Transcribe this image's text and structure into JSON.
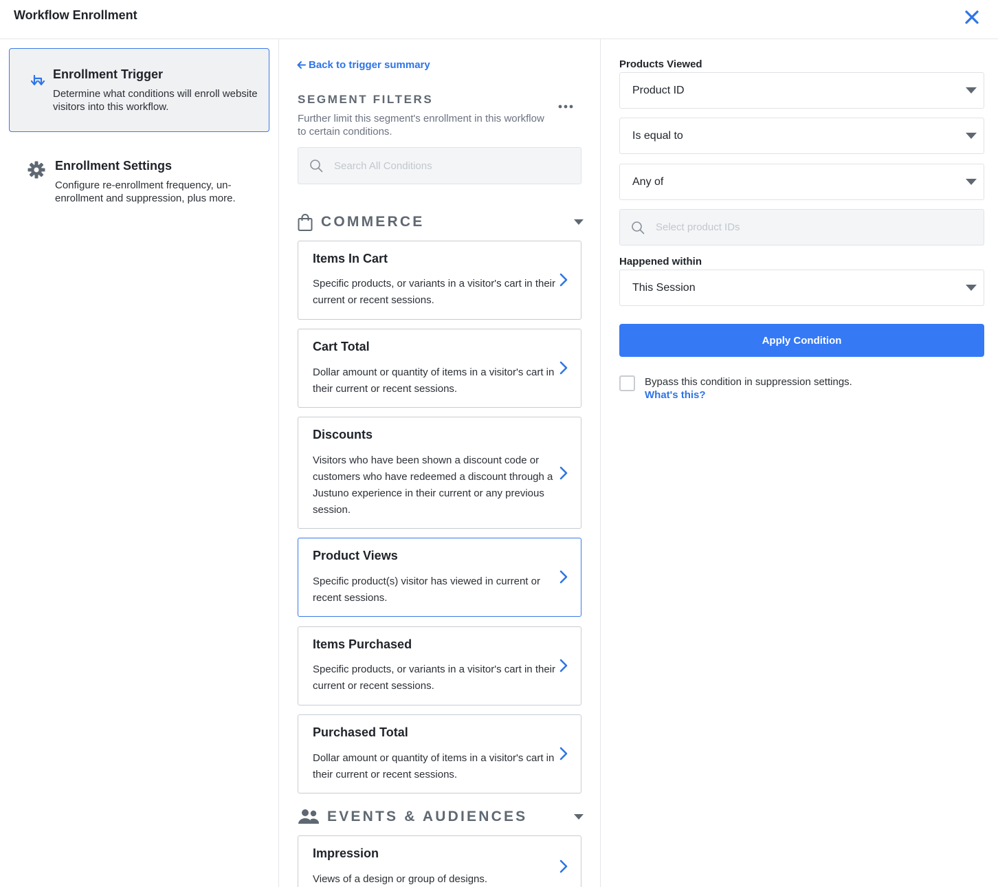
{
  "header": {
    "title": "Workflow Enrollment",
    "close_icon": "close-icon"
  },
  "nav": {
    "items": [
      {
        "title": "Enrollment Trigger",
        "description": "Determine what conditions will enroll website visitors into this workflow.",
        "icon": "trigger-icon",
        "active": true
      },
      {
        "title": "Enrollment Settings",
        "description": "Configure re-enrollment frequency, un-enrollment and suppression, plus more.",
        "icon": "gear-icon",
        "active": false
      }
    ]
  },
  "filters": {
    "back_label": "Back to trigger summary",
    "title": "SEGMENT FILTERS",
    "description": "Further limit this segment's enrollment in this workflow to certain conditions.",
    "search_placeholder": "Search All Conditions",
    "sections": [
      {
        "title": "COMMERCE",
        "icon": "shopping-bag-icon",
        "conditions": [
          {
            "title": "Items In Cart",
            "description": "Specific products, or variants in a visitor's cart in their current or recent sessions."
          },
          {
            "title": "Cart Total",
            "description": "Dollar amount or quantity of items in a visitor's cart in their current or recent sessions."
          },
          {
            "title": "Discounts",
            "description": "Visitors who have been shown a discount code or customers who have redeemed a discount through a Justuno experience in their current or any previous session."
          },
          {
            "title": "Product Views",
            "description": "Specific product(s) visitor has viewed in current or recent sessions.",
            "selected": true
          },
          {
            "title": "Items Purchased",
            "description": "Specific products, or variants in a visitor's cart in their current or recent sessions."
          },
          {
            "title": "Purchased Total",
            "description": "Dollar amount or quantity of items in a visitor's cart in their current or recent sessions."
          }
        ]
      },
      {
        "title": "EVENTS & AUDIENCES",
        "icon": "users-icon",
        "conditions": [
          {
            "title": "Impression",
            "description": "Views of a design or group of designs."
          }
        ]
      }
    ]
  },
  "form": {
    "products_viewed_label": "Products Viewed",
    "attribute_value": "Product ID",
    "operator_value": "Is equal to",
    "match_value": "Any of",
    "product_ids_placeholder": "Select product IDs",
    "happened_within_label": "Happened within",
    "happened_within_value": "This Session",
    "apply_label": "Apply Condition",
    "bypass_label": "Bypass this condition in suppression settings.",
    "bypass_checked": false,
    "whats_this_label": "What's this?"
  },
  "colors": {
    "accent": "#3579f5",
    "link": "#2f74e6",
    "active_border": "#3879e8",
    "section_heading": "#5f6872"
  }
}
